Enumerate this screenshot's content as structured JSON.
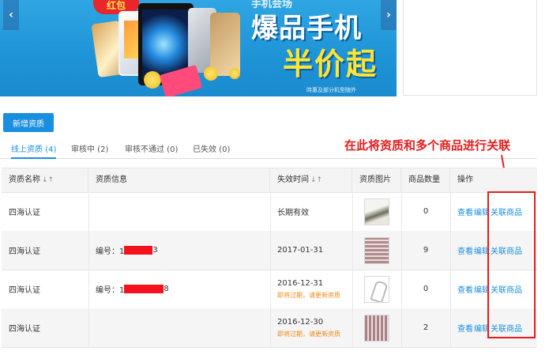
{
  "banner": {
    "red_bag_text": "红包",
    "top_text": "手机会场",
    "headline1": "爆品手机",
    "headline2": "半价起",
    "note": "時惠及部分机型随外",
    "arrow_left": "‹",
    "arrow_right": "›"
  },
  "toolbar": {
    "add_label": "新增资质"
  },
  "tabs": [
    {
      "label": "线上资质 (4)",
      "active": true
    },
    {
      "label": "审核中 (2)",
      "active": false
    },
    {
      "label": "审核不通过 (0)",
      "active": false
    },
    {
      "label": "已失效 (0)",
      "active": false
    }
  ],
  "annotation": "在此将资质和多个商品进行关联",
  "table": {
    "headers": {
      "name": "资质名称",
      "info": "资质信息",
      "expire": "失效时间",
      "image": "资质图片",
      "count": "商品数量",
      "actions": "操作"
    },
    "sort_icon": "↓↑",
    "rows": [
      {
        "name": "四海认证",
        "info_prefix": "",
        "info_suffix": "",
        "date": "长期有效",
        "warning": "",
        "count": "0"
      },
      {
        "name": "四海认证",
        "info_prefix": "编号：1",
        "info_suffix": "3",
        "date": "2017-01-31",
        "warning": "",
        "count": "9"
      },
      {
        "name": "四海认证",
        "info_prefix": "编号：1",
        "info_suffix": "8",
        "date": "2016-12-31",
        "warning": "即将过期，请更新资质",
        "count": "0"
      },
      {
        "name": "四海认证",
        "info_prefix": "",
        "info_suffix": "",
        "date": "2016-12-30",
        "warning": "即将过期，请更新资质",
        "count": "2"
      }
    ],
    "actions": {
      "view": "查看",
      "edit": "编辑",
      "link": "关联商品"
    }
  },
  "colors": {
    "accent": "#1a8fe0",
    "annotation": "#e41d1d",
    "warning": "#f08a17",
    "redaction": "#f4121e"
  }
}
